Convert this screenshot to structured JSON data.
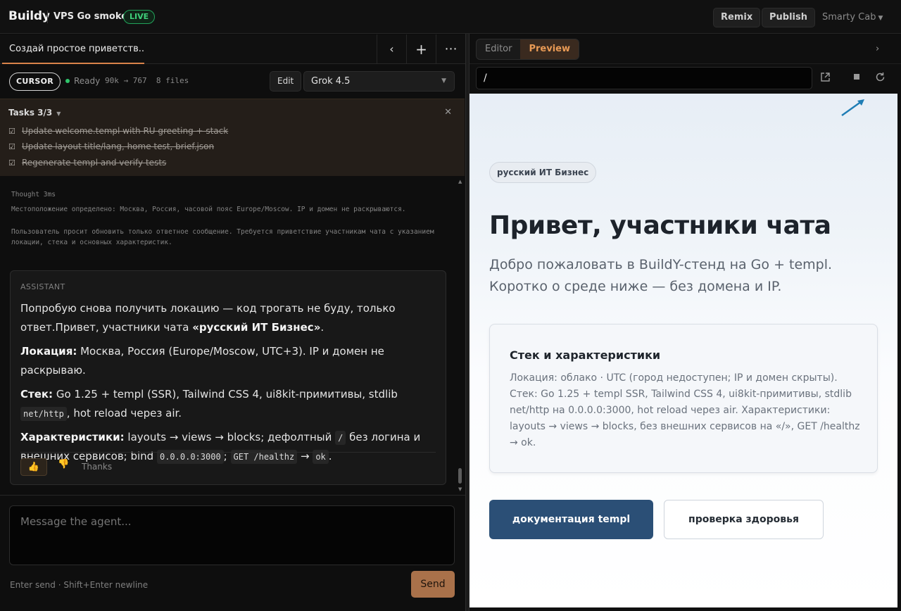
{
  "app": {
    "brand": "Buildy",
    "project": "VPS Go smoke",
    "live_badge": "LIVE",
    "remix_label": "Remix",
    "publish_label": "Publish",
    "account_label": "Smarty Cab"
  },
  "chat": {
    "tab_title": "Создай простое приветств...",
    "tab_icons": [
      "chevron-left-icon",
      "plus-icon",
      "more-icon"
    ],
    "agent_mode": "CURSOR",
    "status": "Ready",
    "stats": "90k → 767  8 files",
    "edit_label": "Edit",
    "model": "Grok 4.5",
    "tasks": {
      "header": "Tasks 3/3",
      "items": [
        {
          "label": "Update welcome.templ with RU greeting + stack",
          "done": true
        },
        {
          "label": "Update layout title/lang, home test, brief.json",
          "done": true
        },
        {
          "label": "Regenerate templ and verify tests",
          "done": true
        }
      ]
    },
    "thought": {
      "label": "Thought 3ms",
      "p1": "Местоположение определено: Москва, Россия, часовой пояс Europe/Moscow. IP и домен не раскрываются.",
      "p2": "Пользователь просит обновить только ответное сообщение. Требуется приветствие участникам чата с указанием локации, стека и основных характеристик."
    },
    "assistant": {
      "label": "ASSISTANT",
      "intro": "Попробую снова получить локацию — код трогать не буду, только ответ.Привет, участники чата ",
      "intro_bold": "«русский ИТ Бизнес»",
      "intro_end": ".",
      "location_label": "Локация:",
      "location_text": " Москва, Россия (Europe/Moscow, UTC+3). IP и домен не раскрываю.",
      "stack_label": "Стек:",
      "stack_text": " Go 1.25 + templ (SSR), Tailwind CSS 4, ui8kit-примитивы, stdlib ",
      "stack_code": "net/http",
      "stack_end": ", hot reload через air.",
      "features_label": "Характеристики:",
      "features_text1": " layouts → views → blocks; дефолтный ",
      "features_code1": "/",
      "features_text2": " без логина и внешних сервисов; bind ",
      "features_code2": "0.0.0.0:3000",
      "features_text3": "; ",
      "features_code3": "GET /healthz",
      "features_text4": " → ",
      "features_code4": "ok",
      "features_end": ".",
      "thanks": "Thanks"
    },
    "composer_placeholder": "Message the agent...",
    "hint": "Enter send · Shift+Enter newline",
    "send_label": "Send"
  },
  "preview": {
    "editor_tab": "Editor",
    "preview_tab": "Preview",
    "url": "/",
    "page": {
      "badge": "русский ИТ Бизнес",
      "title": "Привет, участники чата",
      "subtitle": "Добро пожаловать в BuildY-стенд на Go + templ. Коротко о среде ниже — без домена и IP.",
      "card_title": "Стек и характеристики",
      "card_body": "Локация: облако · UTC (город недоступен; IP и домен скрыты). Стек: Go 1.25 + templ SSR, Tailwind CSS 4, ui8kit-примитивы, stdlib net/http на 0.0.0.0:3000, hot reload через air. Характеристики: layouts → views → blocks, без внешних сервисов на «/», GET /healthz → ok.",
      "primary_button": "документация templ",
      "secondary_button": "проверка здоровья"
    }
  },
  "colors": {
    "accent": "#d9834a",
    "live": "#3fd07a",
    "primary_button": "#2b4f76",
    "send_button": "#a9714a"
  }
}
